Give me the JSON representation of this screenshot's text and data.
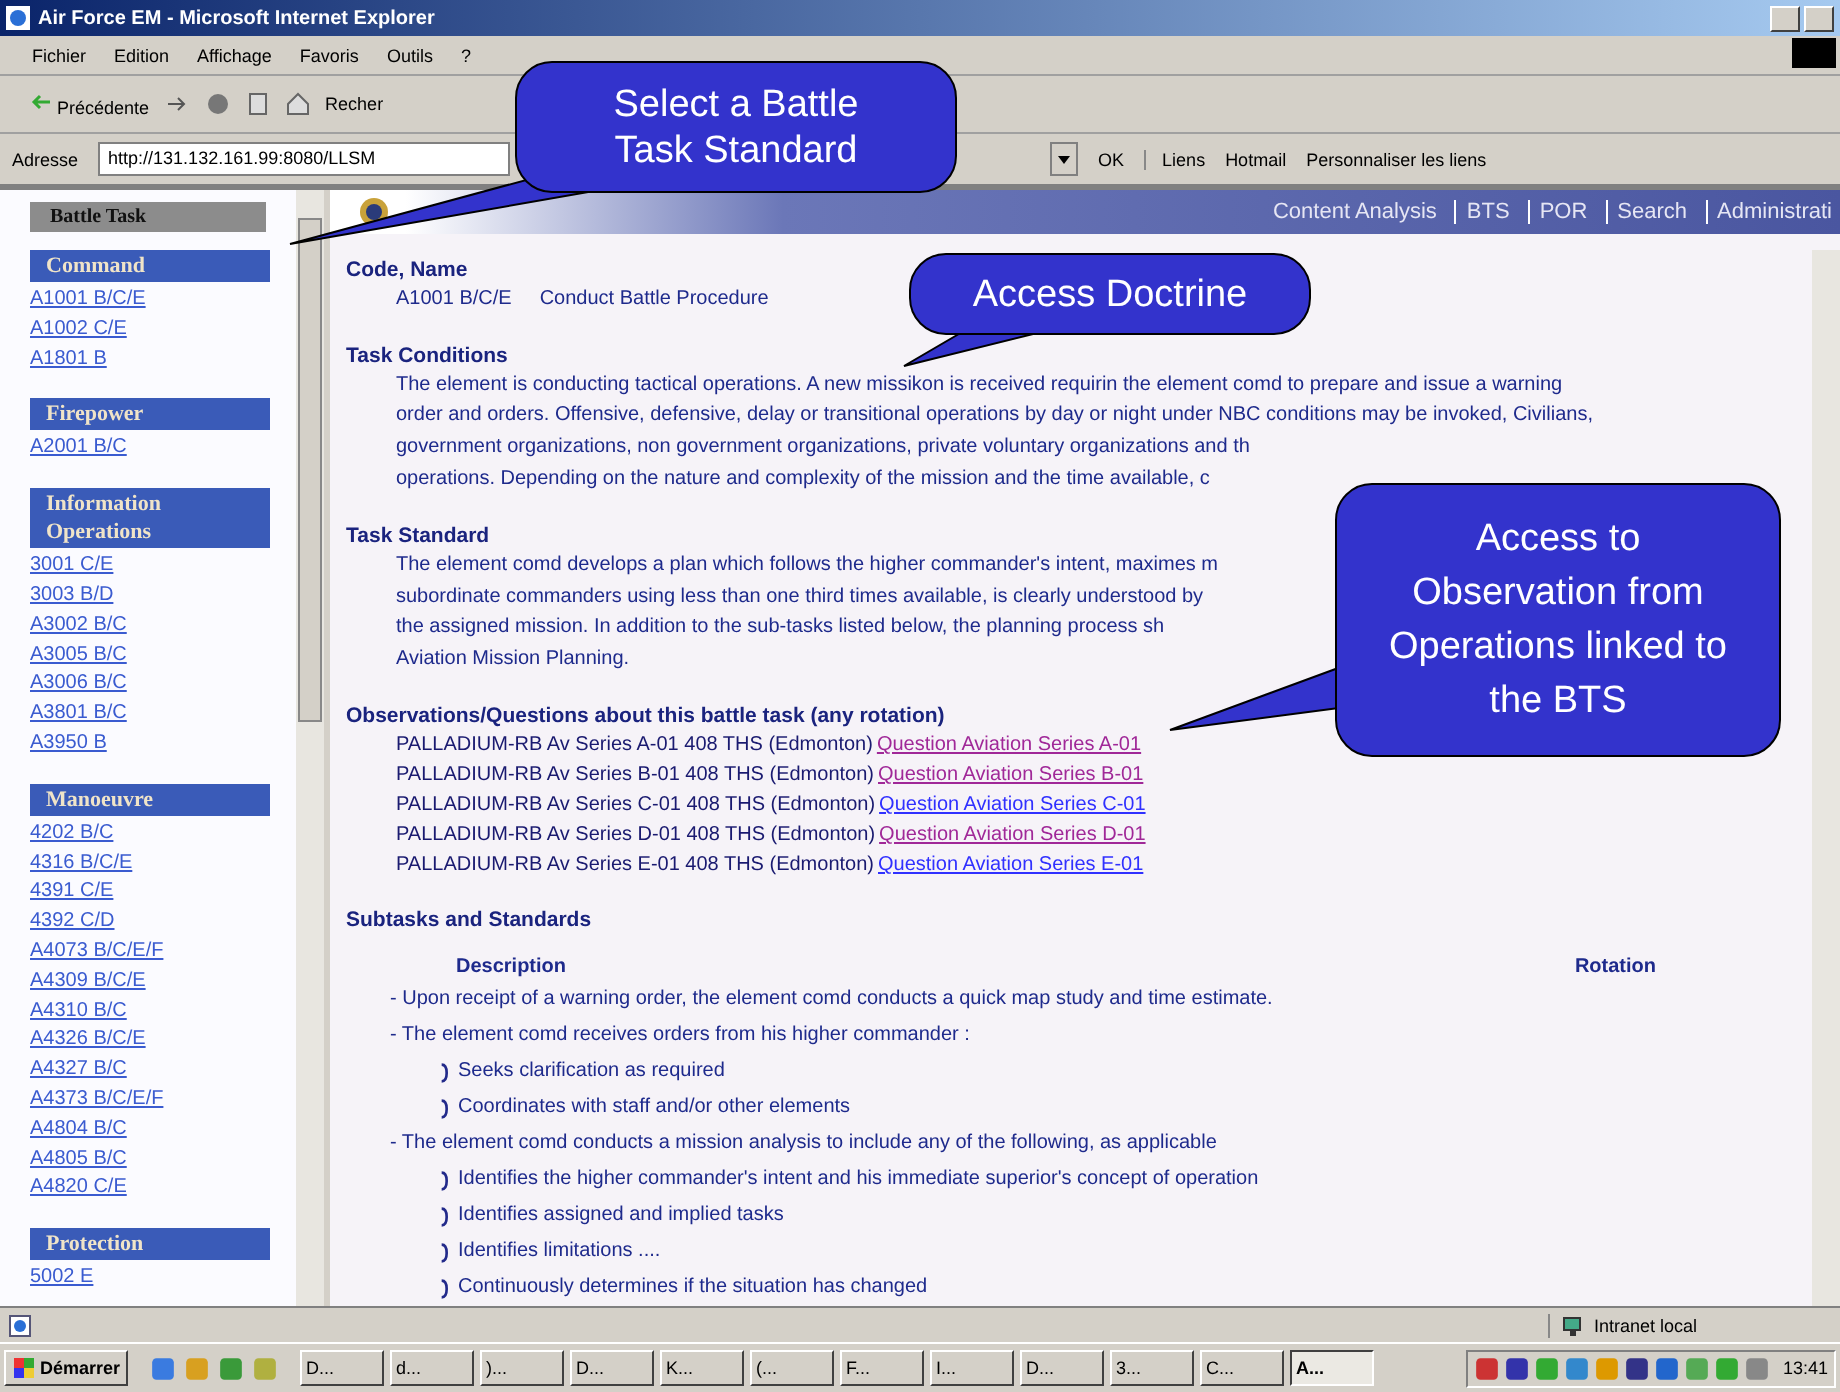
{
  "window": {
    "title": "Air Force EM - Microsoft Internet Explorer"
  },
  "menu": [
    "Fichier",
    "Edition",
    "Affichage",
    "Favoris",
    "Outils",
    "?"
  ],
  "toolbar": {
    "back": "Précédente",
    "search": "Recher"
  },
  "address": {
    "label": "Adresse",
    "url": "http://131.132.161.99:8080/LLSM",
    "go": "OK",
    "links_label": "Liens",
    "links": [
      "Hotmail",
      "Personnaliser les liens"
    ]
  },
  "sidebar": {
    "header": "Battle Task",
    "groups": [
      {
        "title": "Command",
        "items": [
          "A1001 B/C/E",
          "A1002 C/E",
          "A1801 B"
        ]
      },
      {
        "title": "Firepower",
        "items": [
          "A2001 B/C"
        ]
      },
      {
        "title": "Information Operations",
        "items": [
          "3001 C/E",
          "3003 B/D",
          "A3002 B/C",
          "A3005 B/C",
          "A3006 B/C",
          "A3801 B/C",
          "A3950 B"
        ]
      },
      {
        "title": "Manoeuvre",
        "items": [
          "4202 B/C",
          "4316 B/C/E",
          "4391 C/E",
          "4392 C/D",
          "A4073 B/C/E/F",
          "A4309 B/C/E",
          "A4310 B/C",
          "A4326 B/C/E",
          "A4327 B/C",
          "A4373 B/C/E/F",
          "A4804 B/C",
          "A4805 B/C",
          "A4820 C/E"
        ]
      },
      {
        "title": "Protection",
        "items": [
          "5002 E"
        ]
      }
    ]
  },
  "banner": {
    "nav": [
      "Content Analysis",
      "BTS",
      "POR",
      "Search",
      "Administrati"
    ]
  },
  "code_name": {
    "heading": "Code, Name",
    "code": "A1001 B/C/E",
    "name": "Conduct Battle Procedure"
  },
  "task_conditions": {
    "heading": "Task Conditions",
    "lines": [
      "The element is conducting tactical operations. A new missikon is received requirin the element comd to prepare and issue a warning",
      "order and orders. Offensive, defensive, delay or transitional operations by day or night under NBC conditions may be invoked, Civilians,",
      "government organizations, non government organizations, private voluntary organizations and th",
      "operations. Depending on the nature and complexity of the mission and the time available, c"
    ]
  },
  "task_standard": {
    "heading": "Task Standard",
    "lines": [
      "The element comd develops a plan which follows the higher commander's intent, maximes m",
      "subordinate commanders using less than one third times available, is clearly understood by",
      "the assigned mission. In addition to the sub-tasks listed below, the planning process sh",
      "Aviation Mission Planning."
    ]
  },
  "observations": {
    "heading": "Observations/Questions about this battle task (any rotation)",
    "rows": [
      {
        "source": "PALLADIUM-RB Av Series A-01 408 THS (Edmonton)",
        "link": "Question Aviation Series A-01",
        "visited": true
      },
      {
        "source": "PALLADIUM-RB Av Series B-01 408 THS (Edmonton)",
        "link": "Question Aviation Series B-01",
        "visited": true
      },
      {
        "source": "PALLADIUM-RB Av Series C-01 408 THS (Edmonton)",
        "link": "Question Aviation Series C-01",
        "visited": false
      },
      {
        "source": "PALLADIUM-RB Av Series D-01 408 THS (Edmonton)",
        "link": "Question Aviation Series D-01",
        "visited": true
      },
      {
        "source": "PALLADIUM-RB Av Series E-01 408 THS (Edmonton)",
        "link": "Question Aviation Series E-01",
        "visited": false
      }
    ]
  },
  "subtasks": {
    "heading": "Subtasks and Standards",
    "columns": [
      "Description",
      "Rotation"
    ],
    "items": [
      {
        "kind": "dash",
        "text": "- Upon receipt of a warning order, the element comd conducts a quick map study and time estimate."
      },
      {
        "kind": "dash",
        "text": "- The element comd receives orders from his higher commander :"
      },
      {
        "kind": "bullet",
        "text": "Seeks clarification as required"
      },
      {
        "kind": "bullet",
        "text": "Coordinates with staff and/or other elements"
      },
      {
        "kind": "dash",
        "text": "- The element comd conducts a mission analysis to include any of the following, as applicable"
      },
      {
        "kind": "bullet",
        "text": "Identifies the higher commander's intent and his immediate superior's concept of operation"
      },
      {
        "kind": "bullet",
        "text": "Identifies assigned and implied tasks"
      },
      {
        "kind": "bullet",
        "text": "Identifies limitations ...."
      },
      {
        "kind": "bullet",
        "text": "Continuously determines if the situation has changed"
      }
    ]
  },
  "status_bar": {
    "zone": "Intranet local"
  },
  "taskbar": {
    "start": "Démarrer",
    "tasks": [
      {
        "label": "D...",
        "selected": false
      },
      {
        "label": "d...",
        "selected": false
      },
      {
        "label": ")...",
        "selected": false
      },
      {
        "label": "D...",
        "selected": false
      },
      {
        "label": "K...",
        "selected": false
      },
      {
        "label": "(...",
        "selected": false
      },
      {
        "label": "F...",
        "selected": false
      },
      {
        "label": "I...",
        "selected": false
      },
      {
        "label": "D...",
        "selected": false
      },
      {
        "label": "3...",
        "selected": false
      },
      {
        "label": "C...",
        "selected": false
      },
      {
        "label": "A...",
        "selected": true
      }
    ],
    "clock": "13:41"
  },
  "callouts": [
    "Select a Battle Task Standard",
    "Access Doctrine",
    "Access to Observation from Operations linked to the BTS"
  ]
}
